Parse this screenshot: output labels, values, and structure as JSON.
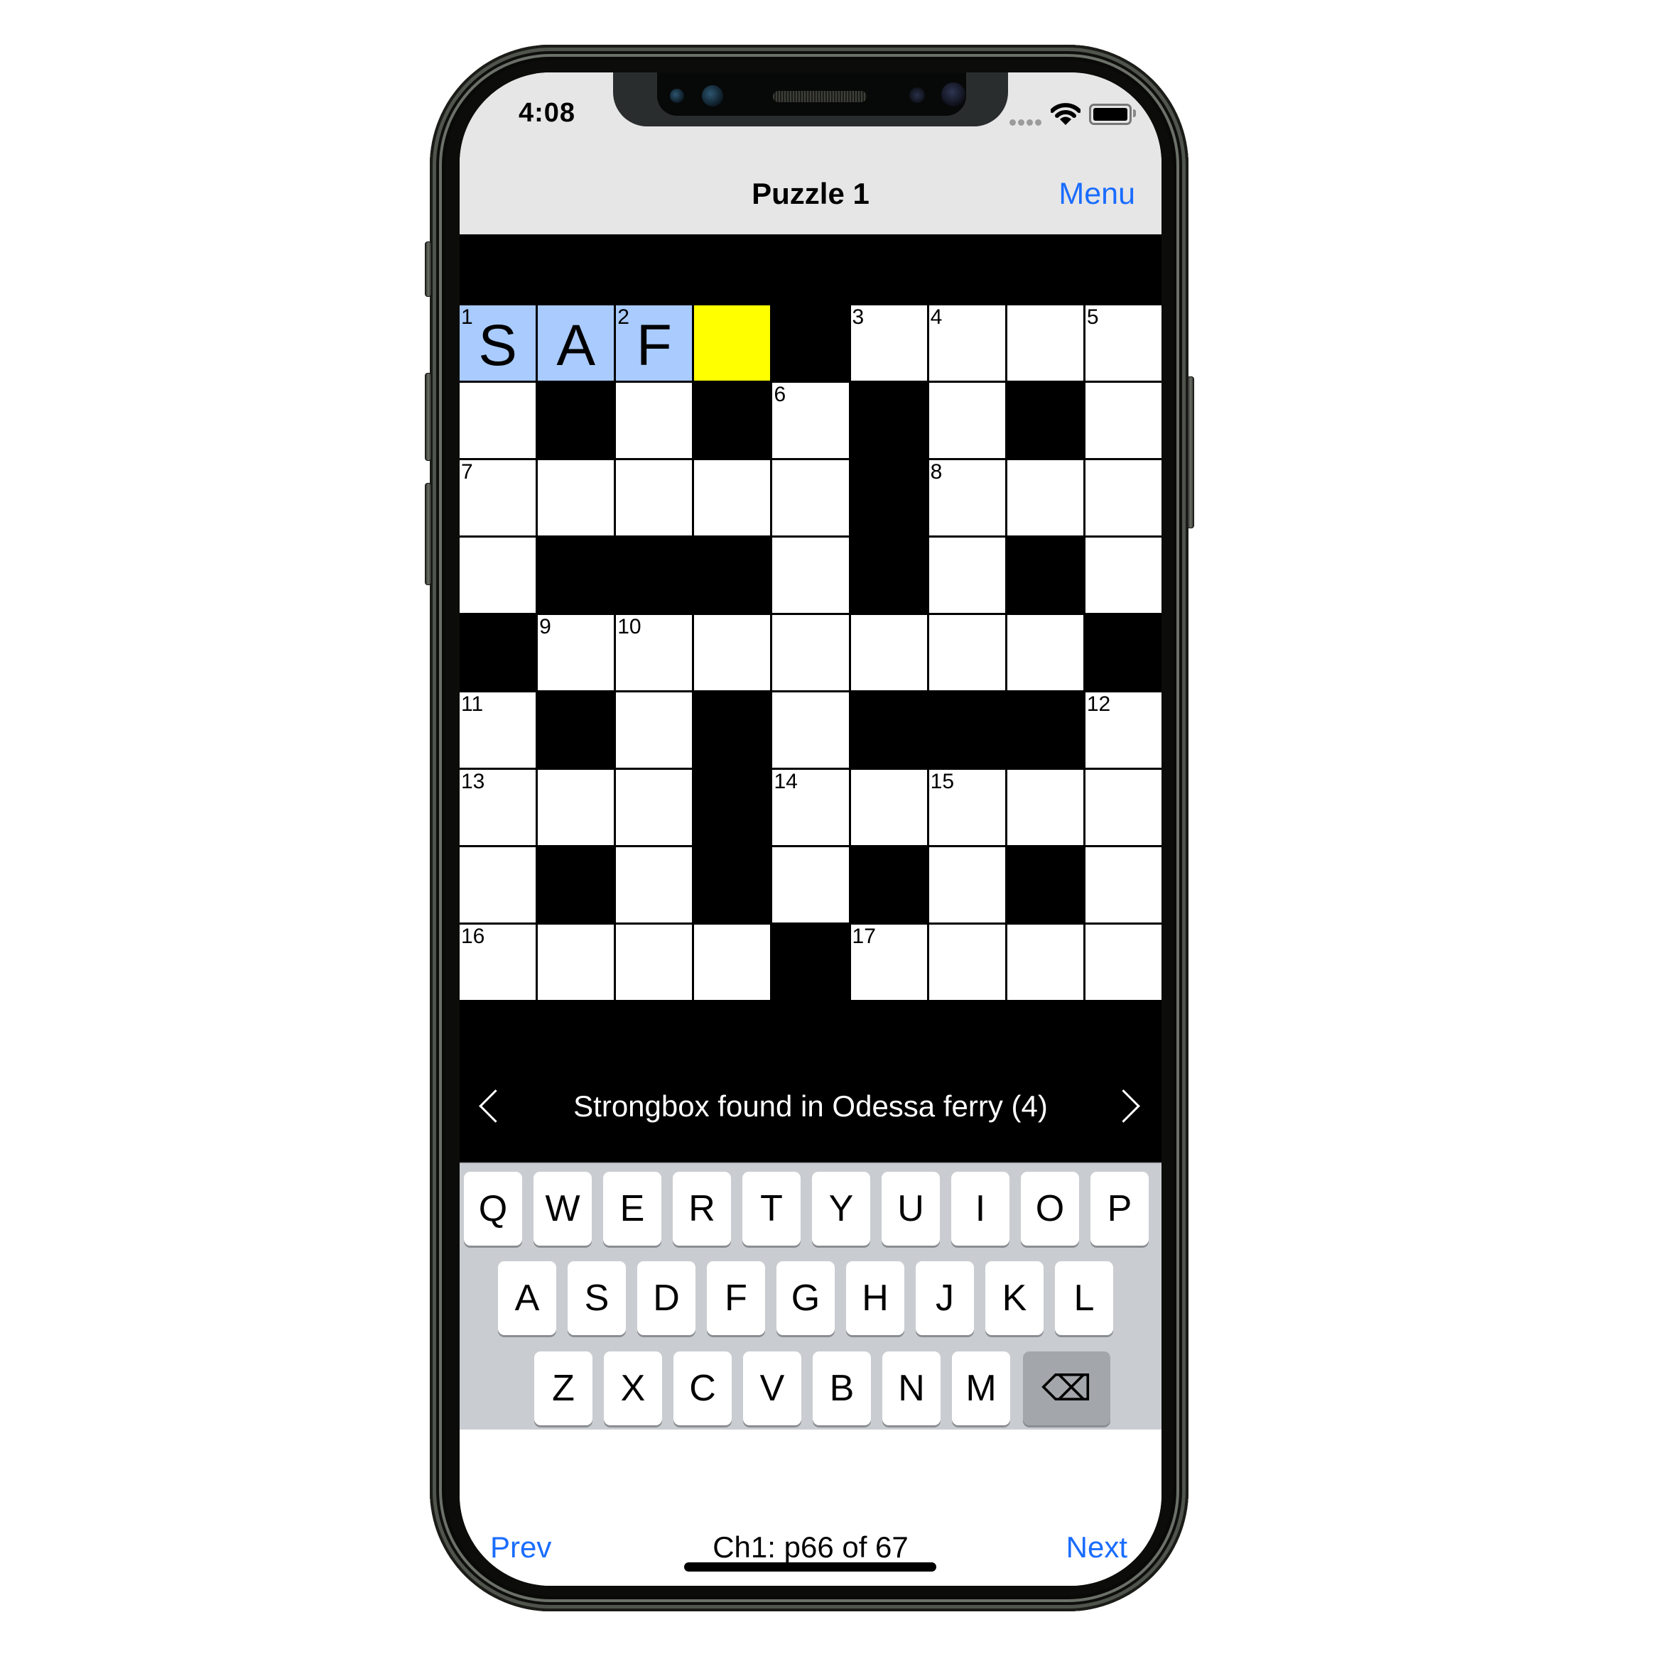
{
  "status_bar": {
    "time": "4:08",
    "signal_icon": "cellular-signal-icon",
    "wifi_icon": "wifi-icon",
    "battery_icon": "battery-icon"
  },
  "nav": {
    "title": "Puzzle 1",
    "menu_label": "Menu"
  },
  "colors": {
    "accent": "#1a6dff",
    "word_highlight": "#a9cbfd",
    "cursor_highlight": "#ffff00",
    "keyboard_bg": "#c9ccd0",
    "delete_key": "#a3a6aa"
  },
  "grid": {
    "rows": 9,
    "cols": 9,
    "cells": [
      [
        {
          "n": "1",
          "l": "S",
          "s": "word"
        },
        {
          "l": "A",
          "s": "word"
        },
        {
          "n": "2",
          "l": "F",
          "s": "word"
        },
        {
          "s": "cursor"
        },
        {
          "b": true
        },
        {
          "n": "3"
        },
        {
          "n": "4"
        },
        {},
        {
          "n": "5"
        }
      ],
      [
        {},
        {
          "b": true
        },
        {},
        {
          "b": true
        },
        {
          "n": "6"
        },
        {
          "b": true
        },
        {},
        {
          "b": true
        },
        {}
      ],
      [
        {
          "n": "7"
        },
        {},
        {},
        {},
        {},
        {
          "b": true
        },
        {
          "n": "8"
        },
        {},
        {}
      ],
      [
        {},
        {
          "b": true
        },
        {
          "b": true
        },
        {
          "b": true
        },
        {},
        {
          "b": true
        },
        {},
        {
          "b": true
        },
        {}
      ],
      [
        {
          "b": true
        },
        {
          "n": "9"
        },
        {
          "n": "10"
        },
        {},
        {},
        {},
        {},
        {},
        {
          "b": true
        }
      ],
      [
        {
          "n": "11"
        },
        {
          "b": true
        },
        {},
        {
          "b": true
        },
        {},
        {
          "b": true
        },
        {
          "b": true
        },
        {
          "b": true
        },
        {
          "n": "12"
        }
      ],
      [
        {
          "n": "13"
        },
        {},
        {},
        {
          "b": true
        },
        {
          "n": "14"
        },
        {},
        {
          "n": "15"
        },
        {},
        {}
      ],
      [
        {},
        {
          "b": true
        },
        {},
        {
          "b": true
        },
        {},
        {
          "b": true
        },
        {},
        {
          "b": true
        },
        {}
      ],
      [
        {
          "n": "16"
        },
        {},
        {},
        {},
        {
          "b": true
        },
        {
          "n": "17"
        },
        {},
        {},
        {}
      ]
    ]
  },
  "clue": {
    "text": "Strongbox found in Odessa ferry (4)",
    "prev_icon": "chevron-left-icon",
    "next_icon": "chevron-right-icon"
  },
  "keyboard": {
    "rows": [
      [
        "Q",
        "W",
        "E",
        "R",
        "T",
        "Y",
        "U",
        "I",
        "O",
        "P"
      ],
      [
        "A",
        "S",
        "D",
        "F",
        "G",
        "H",
        "J",
        "K",
        "L"
      ],
      [
        "Z",
        "X",
        "C",
        "V",
        "B",
        "N",
        "M"
      ]
    ],
    "delete_symbol": "⌫"
  },
  "toolbar": {
    "prev_label": "Prev",
    "page_label": "Ch1: p66 of 67",
    "next_label": "Next"
  }
}
